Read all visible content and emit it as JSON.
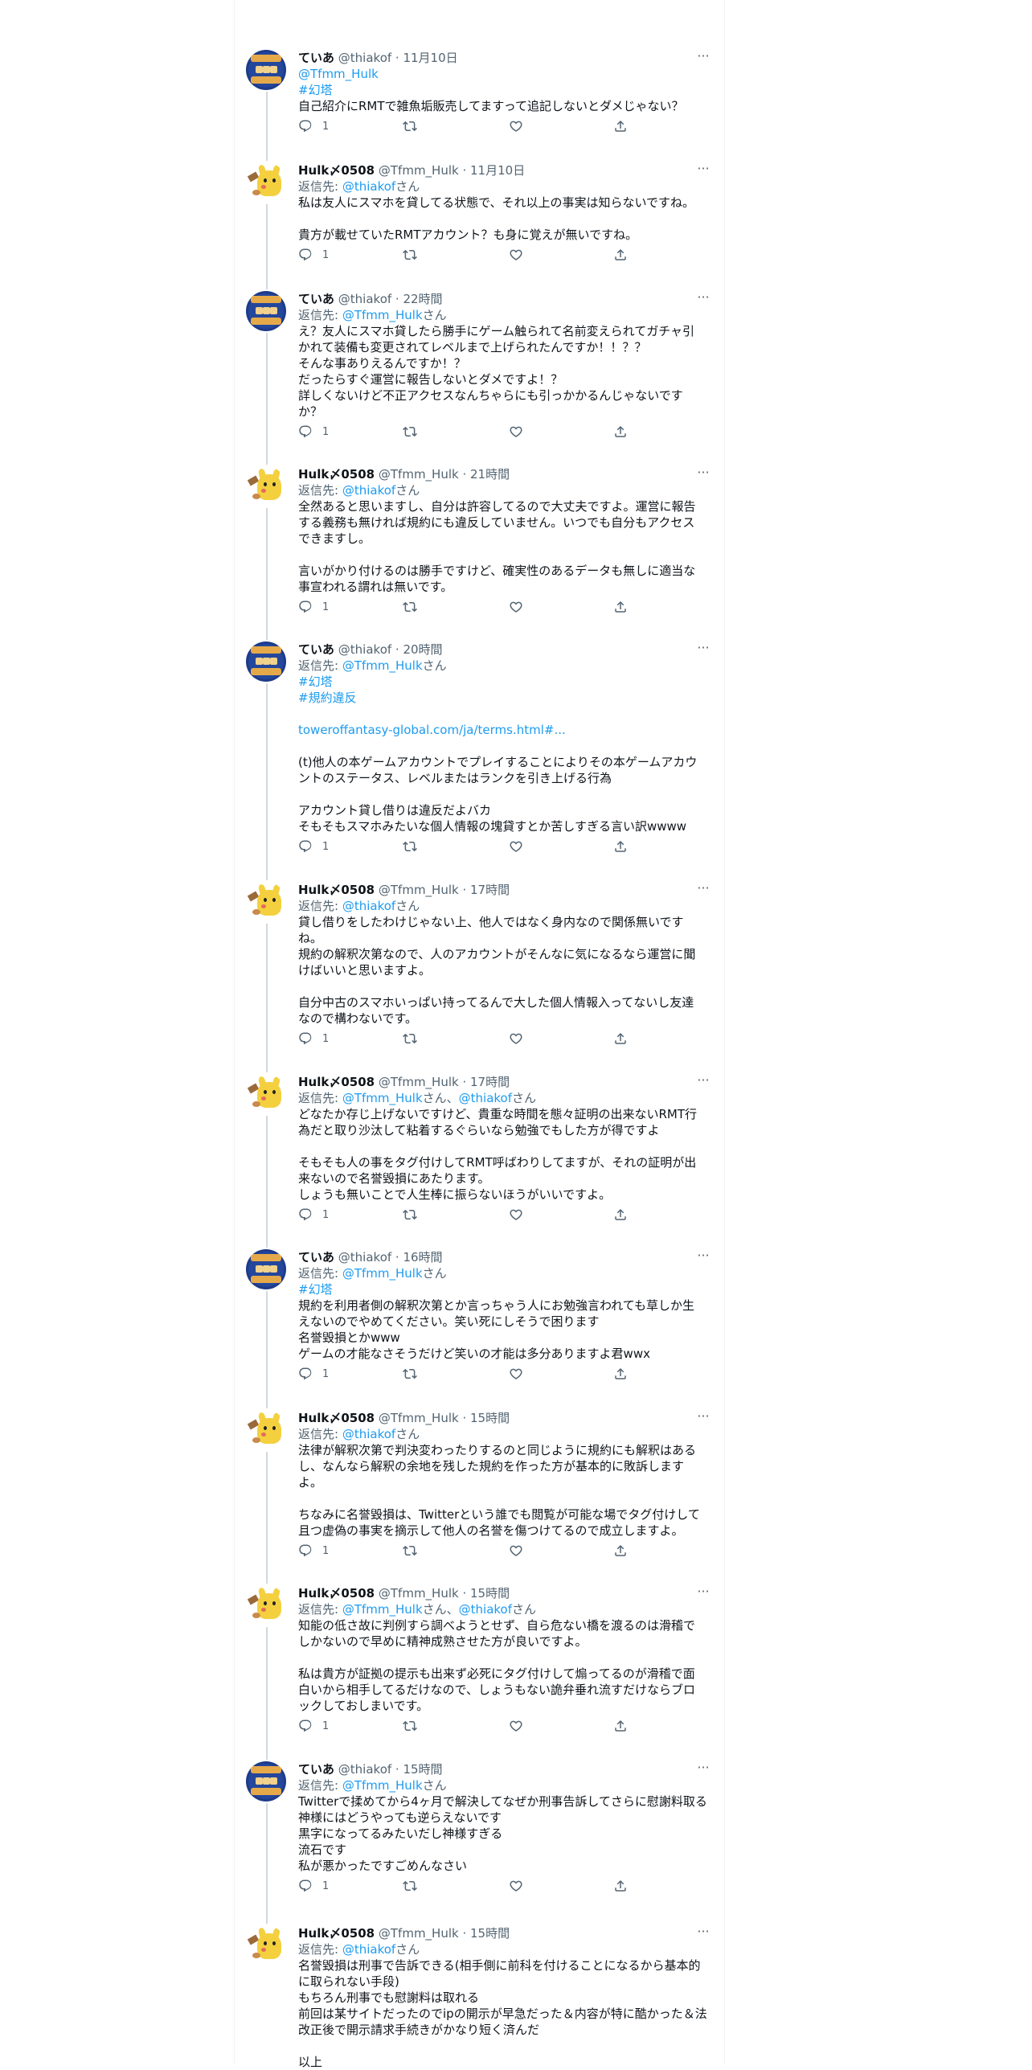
{
  "tweets": [
    {
      "author": "teia",
      "name": "ていあ",
      "handle": "@thiakof",
      "time": "11月10日",
      "replying": null,
      "lines": [
        {
          "kind": "link",
          "text": "@Tfmm_Hulk"
        },
        {
          "kind": "tag",
          "text": "#幻塔"
        },
        {
          "kind": "text",
          "text": "自己紹介にRMTで雑魚垢販売してますって追記しないとダメじゃない？"
        }
      ],
      "reply_count": "1"
    },
    {
      "author": "hulk",
      "name": "Hulk〆0508",
      "handle": "@Tfmm_Hulk",
      "time": "11月10日",
      "replying": {
        "prefix": "返信先: ",
        "targets": [
          "@thiakof"
        ],
        "suffix": "さん"
      },
      "lines": [
        {
          "kind": "text",
          "text": "私は友人にスマホを貸してる状態で、それ以上の事実は知らないですね。"
        },
        {
          "kind": "blank",
          "text": ""
        },
        {
          "kind": "text",
          "text": "貴方が載せていたRMTアカウント？も身に覚えが無いですね。"
        }
      ],
      "reply_count": "1"
    },
    {
      "author": "teia",
      "name": "ていあ",
      "handle": "@thiakof",
      "time": "22時間",
      "replying": {
        "prefix": "返信先: ",
        "targets": [
          "@Tfmm_Hulk"
        ],
        "suffix": "さん"
      },
      "lines": [
        {
          "kind": "text",
          "text": "え？友人にスマホ貸したら勝手にゲーム触られて名前変えられてガチャ引"
        },
        {
          "kind": "text",
          "text": "かれて装備も変更されてレベルまで上げられたんですか！！？？"
        },
        {
          "kind": "text",
          "text": "そんな事ありえるんですか！？"
        },
        {
          "kind": "text",
          "text": "だったらすぐ運営に報告しないとダメですよ！？"
        },
        {
          "kind": "text",
          "text": "詳しくないけど不正アクセスなんちゃらにも引っかかるんじゃないです"
        },
        {
          "kind": "text",
          "text": "か？"
        }
      ],
      "reply_count": "1"
    },
    {
      "author": "hulk",
      "name": "Hulk〆0508",
      "handle": "@Tfmm_Hulk",
      "time": "21時間",
      "replying": {
        "prefix": "返信先: ",
        "targets": [
          "@thiakof"
        ],
        "suffix": "さん"
      },
      "lines": [
        {
          "kind": "text",
          "text": "全然あると思いますし、自分は許容してるので大丈夫ですよ。運営に報告"
        },
        {
          "kind": "text",
          "text": "する義務も無ければ規約にも違反していません。いつでも自分もアクセス"
        },
        {
          "kind": "text",
          "text": "できますし。"
        },
        {
          "kind": "blank",
          "text": ""
        },
        {
          "kind": "text",
          "text": "言いがかり付けるのは勝手ですけど、確実性のあるデータも無しに適当な"
        },
        {
          "kind": "text",
          "text": "事宣われる謂れは無いです。"
        }
      ],
      "reply_count": "1"
    },
    {
      "author": "teia",
      "name": "ていあ",
      "handle": "@thiakof",
      "time": "20時間",
      "replying": {
        "prefix": "返信先: ",
        "targets": [
          "@Tfmm_Hulk"
        ],
        "suffix": "さん"
      },
      "lines": [
        {
          "kind": "tag",
          "text": "#幻塔"
        },
        {
          "kind": "tag",
          "text": "#規約違反"
        },
        {
          "kind": "blank",
          "text": ""
        },
        {
          "kind": "link",
          "text": "toweroffantasy-global.com/ja/terms.html#..."
        },
        {
          "kind": "blank",
          "text": ""
        },
        {
          "kind": "text",
          "text": "(t)他人の本ゲームアカウントでプレイすることによりその本ゲームアカウ"
        },
        {
          "kind": "text",
          "text": "ントのステータス、レベルまたはランクを引き上げる行為"
        },
        {
          "kind": "blank",
          "text": ""
        },
        {
          "kind": "text",
          "text": "アカウント貸し借りは違反だよバカ"
        },
        {
          "kind": "text",
          "text": "そもそもスマホみたいな個人情報の塊貸すとか苦しすぎる言い訳wwww"
        }
      ],
      "reply_count": "1"
    },
    {
      "author": "hulk",
      "name": "Hulk〆0508",
      "handle": "@Tfmm_Hulk",
      "time": "17時間",
      "replying": {
        "prefix": "返信先: ",
        "targets": [
          "@thiakof"
        ],
        "suffix": "さん"
      },
      "lines": [
        {
          "kind": "text",
          "text": "貸し借りをしたわけじゃない上、他人ではなく身内なので関係無いです"
        },
        {
          "kind": "text",
          "text": "ね。"
        },
        {
          "kind": "text",
          "text": "規約の解釈次第なので、人のアカウントがそんなに気になるなら運営に聞"
        },
        {
          "kind": "text",
          "text": "けばいいと思いますよ。"
        },
        {
          "kind": "blank",
          "text": ""
        },
        {
          "kind": "text",
          "text": "自分中古のスマホいっぱい持ってるんで大した個人情報入ってないし友達"
        },
        {
          "kind": "text",
          "text": "なので構わないです。"
        }
      ],
      "reply_count": "1"
    },
    {
      "author": "hulk",
      "name": "Hulk〆0508",
      "handle": "@Tfmm_Hulk",
      "time": "17時間",
      "replying": {
        "prefix": "返信先: ",
        "targets": [
          "@Tfmm_Hulk",
          "@thiakof"
        ],
        "suffix": "さん"
      },
      "lines": [
        {
          "kind": "text",
          "text": "どなたか存じ上げないですけど、貴重な時間を態々証明の出来ないRMT行"
        },
        {
          "kind": "text",
          "text": "為だと取り沙汰して粘着するぐらいなら勉強でもした方が得ですよ"
        },
        {
          "kind": "blank",
          "text": ""
        },
        {
          "kind": "text",
          "text": "そもそも人の事をタグ付けしてRMT呼ばわりしてますが、それの証明が出"
        },
        {
          "kind": "text",
          "text": "来ないので名誉毀損にあたります。"
        },
        {
          "kind": "text",
          "text": "しょうも無いことで人生棒に振らないほうがいいですよ。"
        }
      ],
      "reply_count": "1"
    },
    {
      "author": "teia",
      "name": "ていあ",
      "handle": "@thiakof",
      "time": "16時間",
      "replying": {
        "prefix": "返信先: ",
        "targets": [
          "@Tfmm_Hulk"
        ],
        "suffix": "さん"
      },
      "lines": [
        {
          "kind": "tag",
          "text": "#幻塔"
        },
        {
          "kind": "text",
          "text": "規約を利用者側の解釈次第とか言っちゃう人にお勉強言われても草しか生"
        },
        {
          "kind": "text",
          "text": "えないのでやめてください。笑い死にしそうで困ります"
        },
        {
          "kind": "text",
          "text": "名誉毀損とかwww"
        },
        {
          "kind": "text",
          "text": "ゲームの才能なさそうだけど笑いの才能は多分ありますよ君wwx"
        }
      ],
      "reply_count": "1"
    },
    {
      "author": "hulk",
      "name": "Hulk〆0508",
      "handle": "@Tfmm_Hulk",
      "time": "15時間",
      "replying": {
        "prefix": "返信先: ",
        "targets": [
          "@thiakof"
        ],
        "suffix": "さん"
      },
      "lines": [
        {
          "kind": "text",
          "text": "法律が解釈次第で判決変わったりするのと同じように規約にも解釈はある"
        },
        {
          "kind": "text",
          "text": "し、なんなら解釈の余地を残した規約を作った方が基本的に敗訴します"
        },
        {
          "kind": "text",
          "text": "よ。"
        },
        {
          "kind": "blank",
          "text": ""
        },
        {
          "kind": "text",
          "text": "ちなみに名誉毀損は、Twitterという誰でも閲覧が可能な場でタグ付けして"
        },
        {
          "kind": "text",
          "text": "且つ虚偽の事実を摘示して他人の名誉を傷つけてるので成立しますよ。"
        }
      ],
      "reply_count": "1"
    },
    {
      "author": "hulk",
      "name": "Hulk〆0508",
      "handle": "@Tfmm_Hulk",
      "time": "15時間",
      "replying": {
        "prefix": "返信先: ",
        "targets": [
          "@Tfmm_Hulk",
          "@thiakof"
        ],
        "suffix": "さん"
      },
      "lines": [
        {
          "kind": "text",
          "text": "知能の低さ故に判例すら調べようとせず、自ら危ない橋を渡るのは滑稽で"
        },
        {
          "kind": "text",
          "text": "しかないので早めに精神成熟させた方が良いですよ。"
        },
        {
          "kind": "blank",
          "text": ""
        },
        {
          "kind": "text",
          "text": "私は貴方が証拠の提示も出来ず必死にタグ付けして煽ってるのが滑稽で面"
        },
        {
          "kind": "text",
          "text": "白いから相手してるだけなので、しょうもない詭弁垂れ流すだけならブロ"
        },
        {
          "kind": "text",
          "text": "ックしておしまいです。"
        }
      ],
      "reply_count": "1"
    },
    {
      "author": "teia",
      "name": "ていあ",
      "handle": "@thiakof",
      "time": "15時間",
      "replying": {
        "prefix": "返信先: ",
        "targets": [
          "@Tfmm_Hulk"
        ],
        "suffix": "さん"
      },
      "lines": [
        {
          "kind": "text",
          "text": "Twitterで揉めてから4ヶ月で解決してなぜか刑事告訴してさらに慰謝料取る"
        },
        {
          "kind": "text",
          "text": "神様にはどうやっても逆らえないです"
        },
        {
          "kind": "text",
          "text": "黒字になってるみたいだし神様すぎる"
        },
        {
          "kind": "text",
          "text": "流石です"
        },
        {
          "kind": "text",
          "text": "私が悪かったですごめんなさい"
        }
      ],
      "reply_count": "1"
    },
    {
      "author": "hulk",
      "name": "Hulk〆0508",
      "handle": "@Tfmm_Hulk",
      "time": "15時間",
      "replying": {
        "prefix": "返信先: ",
        "targets": [
          "@thiakof"
        ],
        "suffix": "さん"
      },
      "lines": [
        {
          "kind": "text",
          "text": "名誉毀損は刑事で告訴できる(相手側に前科を付けることになるから基本的"
        },
        {
          "kind": "text",
          "text": "に取られない手段)"
        },
        {
          "kind": "text",
          "text": "もちろん刑事でも慰謝料は取れる"
        },
        {
          "kind": "text",
          "text": "前回は某サイトだったのでipの開示が早急だった＆内容が特に酷かった＆法"
        },
        {
          "kind": "text",
          "text": "改正後で開示請求手続きがかなり短く済んだ"
        },
        {
          "kind": "blank",
          "text": ""
        },
        {
          "kind": "text",
          "text": "以上"
        }
      ],
      "reply_count": null
    }
  ],
  "icons": {
    "more": "more-horizontal-icon",
    "reply": "reply-icon",
    "retweet": "retweet-icon",
    "like": "heart-icon",
    "share": "share-icon"
  },
  "colors": {
    "link": "#1d9bf0",
    "muted": "#536471",
    "text": "#0f1419",
    "thread": "#cfd9de"
  }
}
